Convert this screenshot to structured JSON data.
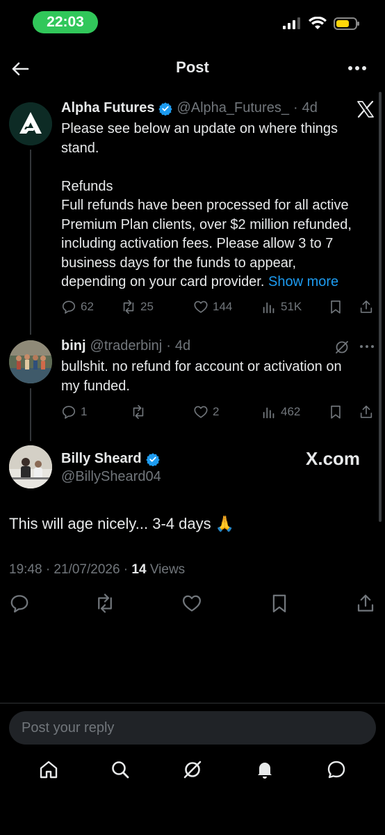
{
  "status_bar": {
    "time": "22:03"
  },
  "header": {
    "title": "Post"
  },
  "tweet1": {
    "name": "Alpha Futures",
    "handle": "@Alpha_Futures_",
    "sep": "·",
    "age": "4d",
    "lines": [
      "Please see below an update on where things",
      "stand.",
      "",
      "Refunds",
      "Full refunds have been processed for all active",
      "Premium Plan clients, over $2 million refunded,",
      "including activation fees. Please allow 3 to 7",
      "business days for the funds to appear,",
      "depending on your card provider."
    ],
    "show_more": "Show more",
    "replies": "62",
    "reposts": "25",
    "likes": "144",
    "views": "51K"
  },
  "tweet2": {
    "name": "binj",
    "handle": "@traderbinj",
    "sep": "·",
    "age": "4d",
    "lines": [
      "bullshit. no refund for account or activation on",
      "my funded."
    ],
    "replies": "1",
    "likes": "2",
    "views": "462"
  },
  "main_post": {
    "name": "Billy Sheard",
    "handle": "@BillySheard04",
    "source": "X.com",
    "text": "This will age nicely... 3-4 days 🙏",
    "timestamp": "19:48 · 21/07/2026 · ",
    "views_count": "14",
    "views_label": " Views"
  },
  "reply_bar": {
    "placeholder": "Post your reply"
  },
  "colors": {
    "accent": "#1d9bf0",
    "background": "#000000",
    "muted": "#71767b",
    "status_pill": "#31c75a"
  },
  "icons": [
    "back-arrow-icon",
    "more-icon",
    "x-logo-icon",
    "verified-icon",
    "reply-icon",
    "repost-icon",
    "like-icon",
    "views-icon",
    "bookmark-icon",
    "share-icon",
    "grok-icon",
    "home-icon",
    "search-icon",
    "notifications-icon",
    "messages-icon"
  ]
}
